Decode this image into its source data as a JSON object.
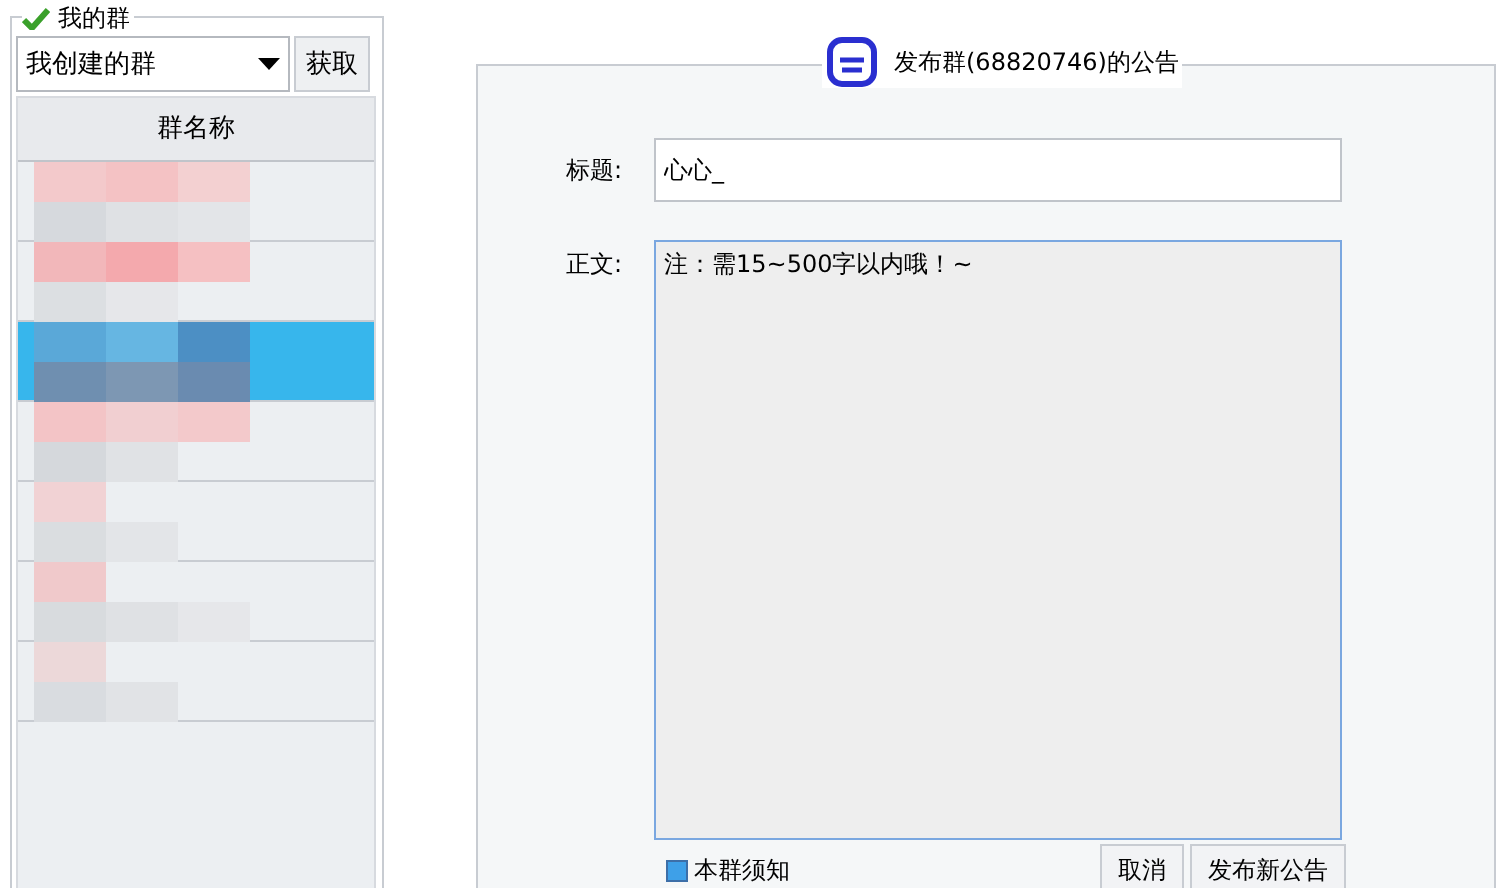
{
  "groups_panel": {
    "title": "我的群",
    "dropdown": {
      "value": "我创建的群"
    },
    "fetch_button": "获取",
    "column_header": "群名称",
    "rows": [
      {
        "selected": false
      },
      {
        "selected": false
      },
      {
        "selected": true
      },
      {
        "selected": false
      },
      {
        "selected": false
      },
      {
        "selected": false
      },
      {
        "selected": false
      }
    ]
  },
  "notice_panel": {
    "title": "发布群(68820746)的公告",
    "title_label": "标题:",
    "title_value": "心心_",
    "body_label": "正文:",
    "body_value": "注：需15~500字以内哦！~",
    "notice_checkbox": {
      "label": "本群须知",
      "checked": true
    },
    "buttons": [
      "取消",
      "发布新公告"
    ]
  }
}
